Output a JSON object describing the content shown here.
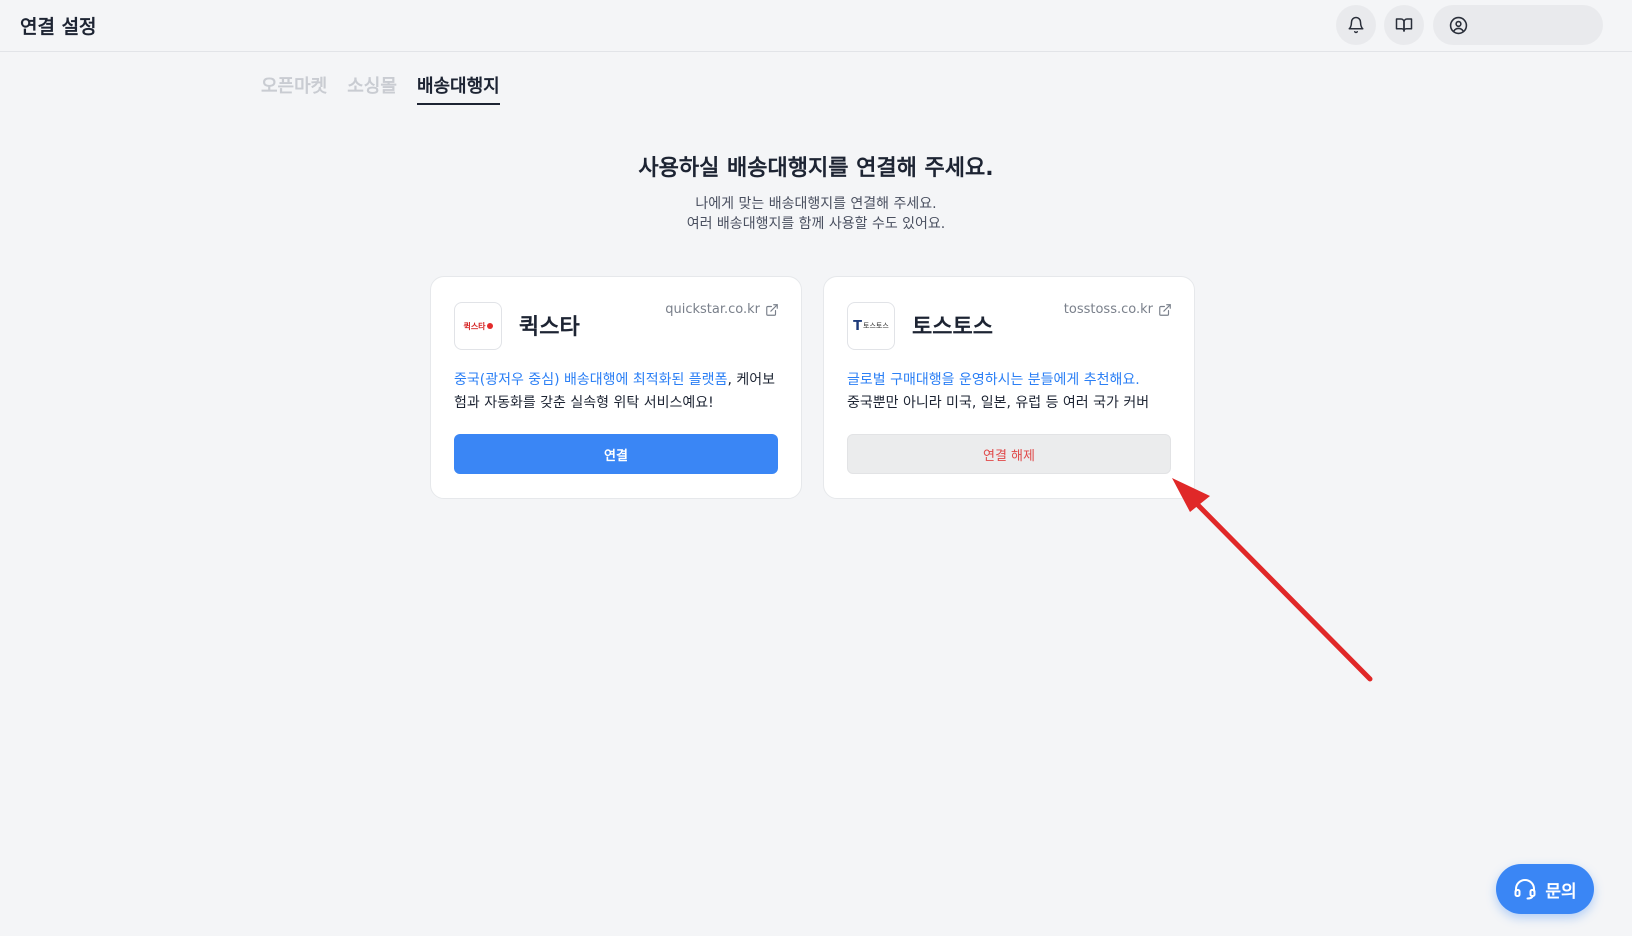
{
  "header": {
    "title": "연결 설정",
    "icons": [
      "bell-icon",
      "book-icon",
      "user-circle-icon"
    ]
  },
  "tabs": [
    {
      "label": "오픈마켓",
      "active": false
    },
    {
      "label": "소싱몰",
      "active": false
    },
    {
      "label": "배송대행지",
      "active": true
    }
  ],
  "hero": {
    "title": "사용하실 배송대행지를 연결해 주세요.",
    "line1": "나에게 맞는 배송대행지를 연결해 주세요.",
    "line2": "여러 배송대행지를 함께 사용할 수도 있어요."
  },
  "cards": [
    {
      "name": "퀵스타",
      "url": "quickstar.co.kr",
      "logo_text": "퀵스타",
      "desc_highlight": "중국(광저우 중심) 배송대행에 최적화된 플랫폼",
      "desc_rest": ", 케어보험과 자동화를 갖춘 실속형 위탁 서비스예요!",
      "button_label": "연결",
      "connected": false
    },
    {
      "name": "토스토스",
      "url": "tosstoss.co.kr",
      "logo_mark": "T",
      "logo_text": "토스토스",
      "desc_highlight": "글로벌 구매대행을 운영하시는 분들에게 추천해요.",
      "desc_rest": "중국뿐만 아니라 미국, 일본, 유럽 등 여러 국가 커버",
      "button_label": "연결 해제",
      "connected": true
    }
  ],
  "help_button": {
    "label": "문의"
  },
  "colors": {
    "accent": "#3a86f5",
    "danger_text": "#e04a4a",
    "annotation_arrow": "#e02828"
  }
}
